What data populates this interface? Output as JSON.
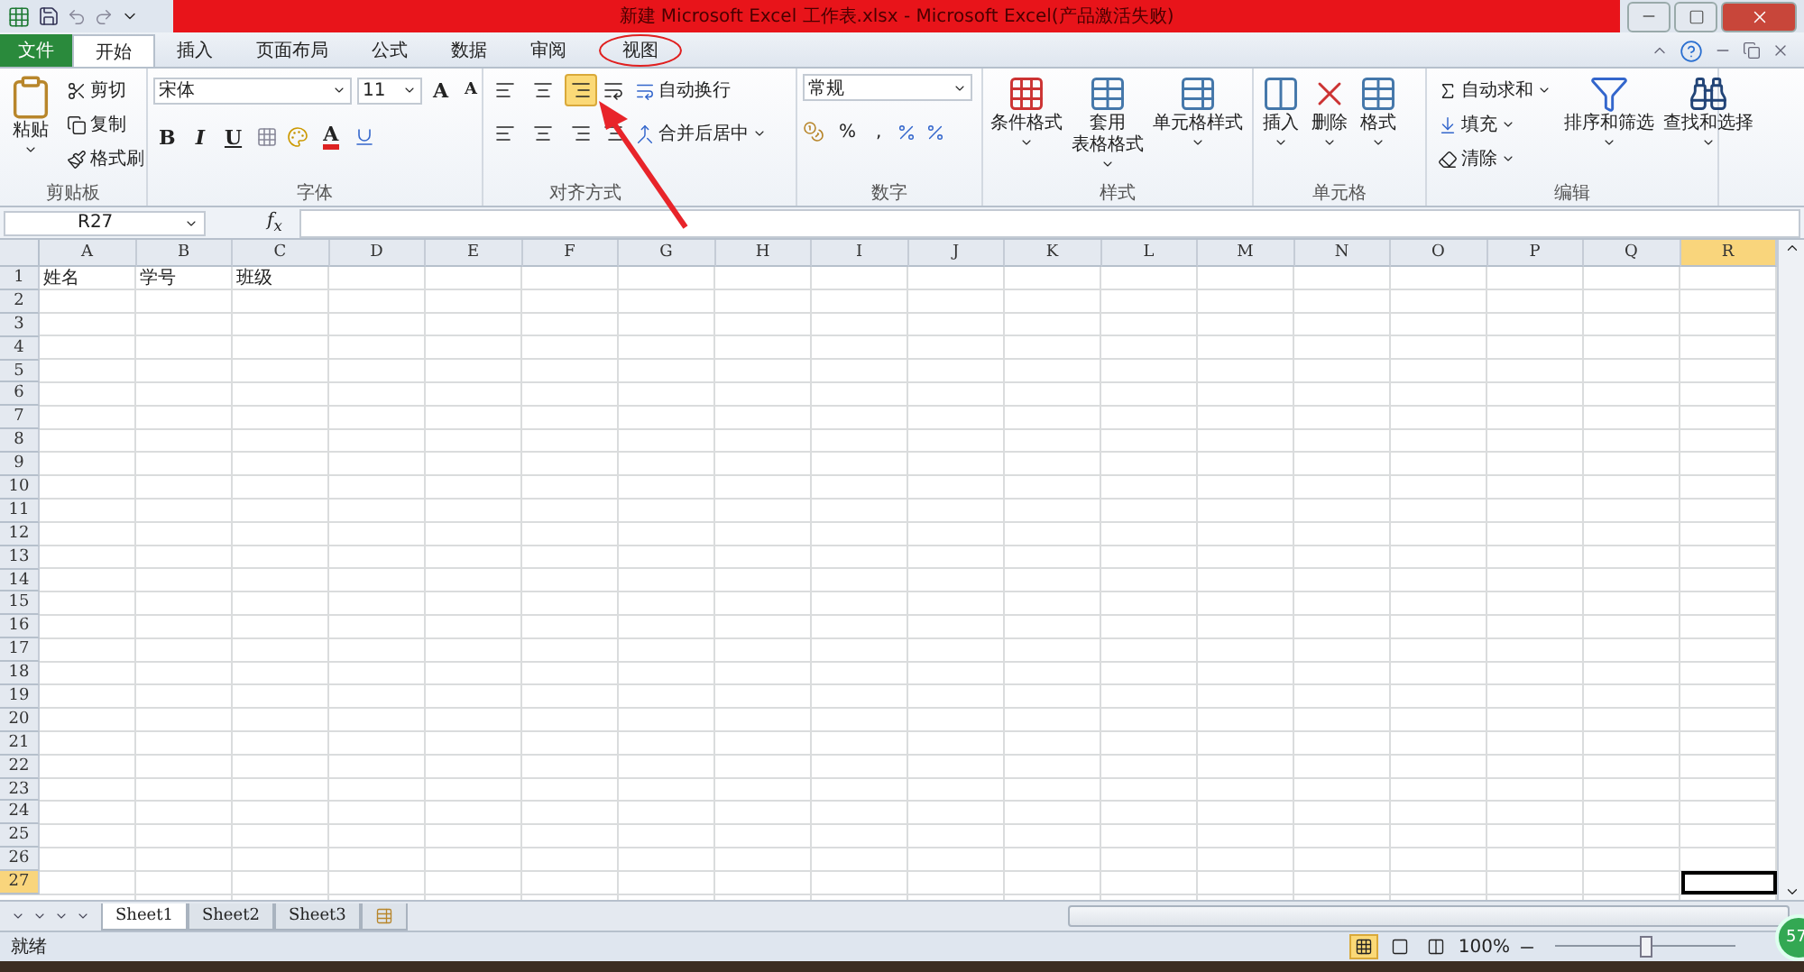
{
  "title_bar": {
    "title": "新建 Microsoft Excel 工作表.xlsx - Microsoft Excel(产品激活失败)",
    "highlighted": true
  },
  "tabs": [
    {
      "label": "文件",
      "kind": "file",
      "selected": false,
      "circled": false
    },
    {
      "label": "开始",
      "kind": "tab",
      "selected": true,
      "circled": false
    },
    {
      "label": "插入",
      "kind": "tab",
      "selected": false,
      "circled": false
    },
    {
      "label": "页面布局",
      "kind": "tab",
      "selected": false,
      "circled": false
    },
    {
      "label": "公式",
      "kind": "tab",
      "selected": false,
      "circled": false
    },
    {
      "label": "数据",
      "kind": "tab",
      "selected": false,
      "circled": false
    },
    {
      "label": "审阅",
      "kind": "tab",
      "selected": false,
      "circled": false
    },
    {
      "label": "视图",
      "kind": "tab",
      "selected": false,
      "circled": true
    }
  ],
  "ribbon": {
    "clipboard": {
      "title": "剪贴板",
      "paste": "粘贴",
      "items": [
        {
          "label": "剪切",
          "kind": "cut"
        },
        {
          "label": "复制",
          "kind": "copy"
        },
        {
          "label": "格式刷",
          "kind": "painter"
        }
      ]
    },
    "font": {
      "title": "字体",
      "font_name": "宋体",
      "font_size": "11",
      "grow": "A",
      "shrink": "A",
      "styles": [
        "B",
        "I",
        "U"
      ],
      "font_color": "A"
    },
    "alignment": {
      "title": "对齐方式",
      "vertical": [
        {
          "kind": "top",
          "selected": false
        },
        {
          "kind": "middle",
          "selected": false
        },
        {
          "kind": "bottom",
          "selected": true
        }
      ],
      "horizontal": [
        {
          "kind": "left",
          "selected": false
        },
        {
          "kind": "center",
          "selected": false
        },
        {
          "kind": "right",
          "selected": false
        }
      ],
      "wrap": "自动换行",
      "merge": "合并后居中"
    },
    "number": {
      "title": "数字",
      "format": "常规",
      "percent": "%",
      "comma": ","
    },
    "styles": {
      "title": "样式",
      "items": [
        {
          "lines": [
            "条件格式"
          ],
          "kind": "conditional"
        },
        {
          "lines": [
            "套用",
            "表格格式"
          ],
          "kind": "table"
        },
        {
          "lines": [
            "单元格样式"
          ],
          "kind": "cellstyle"
        }
      ]
    },
    "cells": {
      "title": "单元格",
      "items": [
        {
          "label": "插入",
          "kind": "insert"
        },
        {
          "label": "删除",
          "kind": "delete"
        },
        {
          "label": "格式",
          "kind": "format"
        }
      ]
    },
    "editing": {
      "title": "编辑",
      "small": [
        {
          "label": "自动求和",
          "kind": "sum"
        },
        {
          "label": "填充",
          "kind": "fill"
        },
        {
          "label": "清除",
          "kind": "clear"
        }
      ],
      "large": [
        {
          "label": "排序和筛选",
          "kind": "sort"
        },
        {
          "label": "查找和选择",
          "kind": "find"
        }
      ]
    }
  },
  "formula_bar": {
    "name_box": "R27",
    "function_label": "f$_{x}$"
  },
  "sheet": {
    "columns": [
      {
        "label": "A",
        "selected": false
      },
      {
        "label": "B",
        "selected": false
      },
      {
        "label": "C",
        "selected": false
      },
      {
        "label": "D",
        "selected": false
      },
      {
        "label": "E",
        "selected": false
      },
      {
        "label": "F",
        "selected": false
      },
      {
        "label": "G",
        "selected": false
      },
      {
        "label": "H",
        "selected": false
      },
      {
        "label": "I",
        "selected": false
      },
      {
        "label": "J",
        "selected": false
      },
      {
        "label": "K",
        "selected": false
      },
      {
        "label": "L",
        "selected": false
      },
      {
        "label": "M",
        "selected": false
      },
      {
        "label": "N",
        "selected": false
      },
      {
        "label": "O",
        "selected": false
      },
      {
        "label": "P",
        "selected": false
      },
      {
        "label": "Q",
        "selected": false
      },
      {
        "label": "R",
        "selected": true
      }
    ],
    "rows": [
      {
        "label": "1",
        "selected": false,
        "cells": [
          "姓名",
          "学号",
          "班级"
        ]
      },
      {
        "label": "2",
        "selected": false
      },
      {
        "label": "3",
        "selected": false
      },
      {
        "label": "4",
        "selected": false
      },
      {
        "label": "5",
        "selected": false
      },
      {
        "label": "6",
        "selected": false
      },
      {
        "label": "7",
        "selected": false
      },
      {
        "label": "8",
        "selected": false
      },
      {
        "label": "9",
        "selected": false
      },
      {
        "label": "10",
        "selected": false
      },
      {
        "label": "11",
        "selected": false
      },
      {
        "label": "12",
        "selected": false
      },
      {
        "label": "13",
        "selected": false
      },
      {
        "label": "14",
        "selected": false
      },
      {
        "label": "15",
        "selected": false
      },
      {
        "label": "16",
        "selected": false
      },
      {
        "label": "17",
        "selected": false
      },
      {
        "label": "18",
        "selected": false
      },
      {
        "label": "19",
        "selected": false
      },
      {
        "label": "20",
        "selected": false
      },
      {
        "label": "21",
        "selected": false
      },
      {
        "label": "22",
        "selected": false
      },
      {
        "label": "23",
        "selected": false
      },
      {
        "label": "24",
        "selected": false
      },
      {
        "label": "25",
        "selected": false
      },
      {
        "label": "26",
        "selected": false
      },
      {
        "label": "27",
        "selected": true
      }
    ]
  },
  "sheet_tabs": [
    {
      "label": "Sheet1",
      "selected": true
    },
    {
      "label": "Sheet2",
      "selected": false
    },
    {
      "label": "Sheet3",
      "selected": false
    }
  ],
  "status_bar": {
    "status": "就绪",
    "views": [
      {
        "kind": "normal",
        "selected": true
      },
      {
        "kind": "layout",
        "selected": false
      },
      {
        "kind": "pagebreak",
        "selected": false
      }
    ],
    "zoom": "100%",
    "zoom_slider": {
      "level": 0.5
    }
  },
  "badge": "57"
}
